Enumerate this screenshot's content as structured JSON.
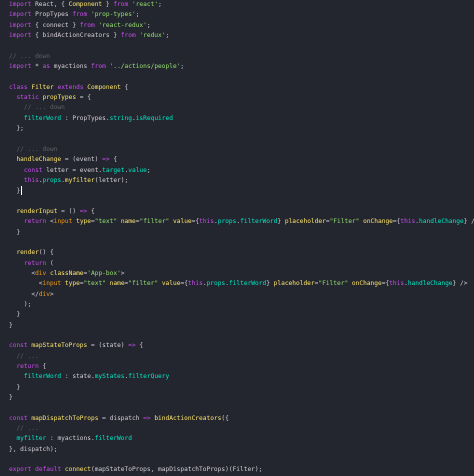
{
  "colors": {
    "background": "#23262e",
    "keyword": "#c74ded",
    "default": "#d5ced9",
    "string": "#96e072",
    "property": "#00e8c6",
    "function": "#ffe66d",
    "comment": "#5f6167",
    "tag": "#f39c12",
    "attr": "#ffe66d",
    "class": "#ffe66d",
    "operator": "#ee5d43"
  },
  "code_lines": [
    [
      [
        "keyword",
        "import"
      ],
      [
        "default",
        " React, { "
      ],
      [
        "class",
        "Component"
      ],
      [
        "default",
        " } "
      ],
      [
        "keyword",
        "from"
      ],
      [
        "default",
        " "
      ],
      [
        "string",
        "'react'"
      ],
      [
        "default",
        ";"
      ]
    ],
    [
      [
        "keyword",
        "import"
      ],
      [
        "default",
        " PropTypes "
      ],
      [
        "keyword",
        "from"
      ],
      [
        "default",
        " "
      ],
      [
        "string",
        "'prop-types'"
      ],
      [
        "default",
        ";"
      ]
    ],
    [
      [
        "keyword",
        "import"
      ],
      [
        "default",
        " { connect } "
      ],
      [
        "keyword",
        "from"
      ],
      [
        "default",
        " "
      ],
      [
        "string",
        "'react-redux'"
      ],
      [
        "default",
        ";"
      ]
    ],
    [
      [
        "keyword",
        "import"
      ],
      [
        "default",
        " { bindActionCreators } "
      ],
      [
        "keyword",
        "from"
      ],
      [
        "default",
        " "
      ],
      [
        "string",
        "'redux'"
      ],
      [
        "default",
        ";"
      ]
    ],
    [],
    [
      [
        "comment",
        "// ... down"
      ]
    ],
    [
      [
        "keyword",
        "import"
      ],
      [
        "default",
        " * "
      ],
      [
        "keyword",
        "as"
      ],
      [
        "default",
        " myactions "
      ],
      [
        "keyword",
        "from"
      ],
      [
        "default",
        " "
      ],
      [
        "string",
        "'../actions/people'"
      ],
      [
        "default",
        ";"
      ]
    ],
    [],
    [
      [
        "keyword",
        "class"
      ],
      [
        "default",
        " "
      ],
      [
        "class",
        "Filter"
      ],
      [
        "default",
        " "
      ],
      [
        "keyword",
        "extends"
      ],
      [
        "default",
        " "
      ],
      [
        "class",
        "Component"
      ],
      [
        "default",
        " {"
      ]
    ],
    [
      [
        "default",
        "  "
      ],
      [
        "keyword",
        "static"
      ],
      [
        "default",
        " "
      ],
      [
        "function",
        "propTypes"
      ],
      [
        "default",
        " = {"
      ]
    ],
    [
      [
        "default",
        "    "
      ],
      [
        "comment",
        "// ... down"
      ]
    ],
    [
      [
        "default",
        "    "
      ],
      [
        "property",
        "filterWord"
      ],
      [
        "default",
        " : PropTypes."
      ],
      [
        "property",
        "string"
      ],
      [
        "default",
        "."
      ],
      [
        "property",
        "isRequired"
      ]
    ],
    [
      [
        "default",
        "  };"
      ]
    ],
    [],
    [
      [
        "default",
        "  "
      ],
      [
        "comment",
        "// ... down"
      ]
    ],
    [
      [
        "default",
        "  "
      ],
      [
        "function",
        "handleChange"
      ],
      [
        "default",
        " = (event) "
      ],
      [
        "keyword",
        "=>"
      ],
      [
        "default",
        " {"
      ]
    ],
    [
      [
        "default",
        "    "
      ],
      [
        "keyword",
        "const"
      ],
      [
        "default",
        " letter = event."
      ],
      [
        "property",
        "target"
      ],
      [
        "default",
        "."
      ],
      [
        "property",
        "value"
      ],
      [
        "default",
        ";"
      ]
    ],
    [
      [
        "default",
        "    "
      ],
      [
        "keyword",
        "this"
      ],
      [
        "default",
        "."
      ],
      [
        "property",
        "props"
      ],
      [
        "default",
        "."
      ],
      [
        "function",
        "myfilter"
      ],
      [
        "default",
        "(letter);"
      ]
    ],
    [
      [
        "default",
        "  }"
      ]
    ],
    [],
    [
      [
        "default",
        "  "
      ],
      [
        "function",
        "renderInput"
      ],
      [
        "default",
        " = () "
      ],
      [
        "keyword",
        "=>"
      ],
      [
        "default",
        " {"
      ]
    ],
    [
      [
        "default",
        "    "
      ],
      [
        "keyword",
        "return"
      ],
      [
        "default",
        " <"
      ],
      [
        "tag",
        "input"
      ],
      [
        "default",
        " "
      ],
      [
        "attr",
        "type"
      ],
      [
        "default",
        "="
      ],
      [
        "string",
        "\"text\""
      ],
      [
        "default",
        " "
      ],
      [
        "attr",
        "name"
      ],
      [
        "default",
        "="
      ],
      [
        "string",
        "\"filter\""
      ],
      [
        "default",
        " "
      ],
      [
        "attr",
        "value"
      ],
      [
        "default",
        "={"
      ],
      [
        "keyword",
        "this"
      ],
      [
        "default",
        "."
      ],
      [
        "property",
        "props"
      ],
      [
        "default",
        "."
      ],
      [
        "property",
        "filterWord"
      ],
      [
        "default",
        "} "
      ],
      [
        "attr",
        "placeholder"
      ],
      [
        "default",
        "="
      ],
      [
        "string",
        "\"Filter\""
      ],
      [
        "default",
        " "
      ],
      [
        "attr",
        "onChange"
      ],
      [
        "default",
        "={"
      ],
      [
        "keyword",
        "this"
      ],
      [
        "default",
        "."
      ],
      [
        "property",
        "handleChange"
      ],
      [
        "default",
        "} />"
      ]
    ],
    [
      [
        "default",
        "  }"
      ]
    ],
    [],
    [
      [
        "default",
        "  "
      ],
      [
        "function",
        "render"
      ],
      [
        "default",
        "() {"
      ]
    ],
    [
      [
        "default",
        "    "
      ],
      [
        "keyword",
        "return"
      ],
      [
        "default",
        " ("
      ]
    ],
    [
      [
        "default",
        "      <"
      ],
      [
        "tag",
        "div"
      ],
      [
        "default",
        " "
      ],
      [
        "attr",
        "className"
      ],
      [
        "default",
        "="
      ],
      [
        "string",
        "'App-box'"
      ],
      [
        "default",
        ">"
      ]
    ],
    [
      [
        "default",
        "        <"
      ],
      [
        "tag",
        "input"
      ],
      [
        "default",
        " "
      ],
      [
        "attr",
        "type"
      ],
      [
        "default",
        "="
      ],
      [
        "string",
        "\"text\""
      ],
      [
        "default",
        " "
      ],
      [
        "attr",
        "name"
      ],
      [
        "default",
        "="
      ],
      [
        "string",
        "\"filter\""
      ],
      [
        "default",
        " "
      ],
      [
        "attr",
        "value"
      ],
      [
        "default",
        "={"
      ],
      [
        "keyword",
        "this"
      ],
      [
        "default",
        "."
      ],
      [
        "property",
        "props"
      ],
      [
        "default",
        "."
      ],
      [
        "property",
        "filterWord"
      ],
      [
        "default",
        "} "
      ],
      [
        "attr",
        "placeholder"
      ],
      [
        "default",
        "="
      ],
      [
        "string",
        "\"Filter\""
      ],
      [
        "default",
        " "
      ],
      [
        "attr",
        "onChange"
      ],
      [
        "default",
        "={"
      ],
      [
        "keyword",
        "this"
      ],
      [
        "default",
        "."
      ],
      [
        "property",
        "handleChange"
      ],
      [
        "default",
        "} />"
      ]
    ],
    [
      [
        "default",
        "      </"
      ],
      [
        "tag",
        "div"
      ],
      [
        "default",
        ">"
      ]
    ],
    [
      [
        "default",
        "    );"
      ]
    ],
    [
      [
        "default",
        "  }"
      ]
    ],
    [
      [
        "default",
        "}"
      ]
    ],
    [],
    [
      [
        "keyword",
        "const"
      ],
      [
        "default",
        " "
      ],
      [
        "function",
        "mapStateToProps"
      ],
      [
        "default",
        " = (state) "
      ],
      [
        "keyword",
        "=>"
      ],
      [
        "default",
        " {"
      ]
    ],
    [
      [
        "default",
        "  "
      ],
      [
        "comment",
        "// ..."
      ]
    ],
    [
      [
        "default",
        "  "
      ],
      [
        "keyword",
        "return"
      ],
      [
        "default",
        " {"
      ]
    ],
    [
      [
        "default",
        "    "
      ],
      [
        "property",
        "filterWord"
      ],
      [
        "default",
        " : state."
      ],
      [
        "property",
        "myStates"
      ],
      [
        "default",
        "."
      ],
      [
        "property",
        "filterQuery"
      ]
    ],
    [
      [
        "default",
        "  }"
      ]
    ],
    [
      [
        "default",
        "}"
      ]
    ],
    [],
    [
      [
        "keyword",
        "const"
      ],
      [
        "default",
        " "
      ],
      [
        "function",
        "mapDispatchToProps"
      ],
      [
        "default",
        " = dispatch "
      ],
      [
        "keyword",
        "=>"
      ],
      [
        "default",
        " "
      ],
      [
        "function",
        "bindActionCreators"
      ],
      [
        "default",
        "({"
      ]
    ],
    [
      [
        "default",
        "  "
      ],
      [
        "comment",
        "// ..."
      ]
    ],
    [
      [
        "default",
        "  "
      ],
      [
        "property",
        "myfilter"
      ],
      [
        "default",
        " : myactions."
      ],
      [
        "property",
        "filterWord"
      ]
    ],
    [
      [
        "default",
        "}, dispatch);"
      ]
    ],
    [],
    [
      [
        "keyword",
        "export"
      ],
      [
        "default",
        " "
      ],
      [
        "keyword",
        "default"
      ],
      [
        "default",
        " "
      ],
      [
        "function",
        "connect"
      ],
      [
        "default",
        "(mapStateToProps, mapDispatchToProps)(Filter);"
      ]
    ]
  ],
  "cursor_line": 18
}
